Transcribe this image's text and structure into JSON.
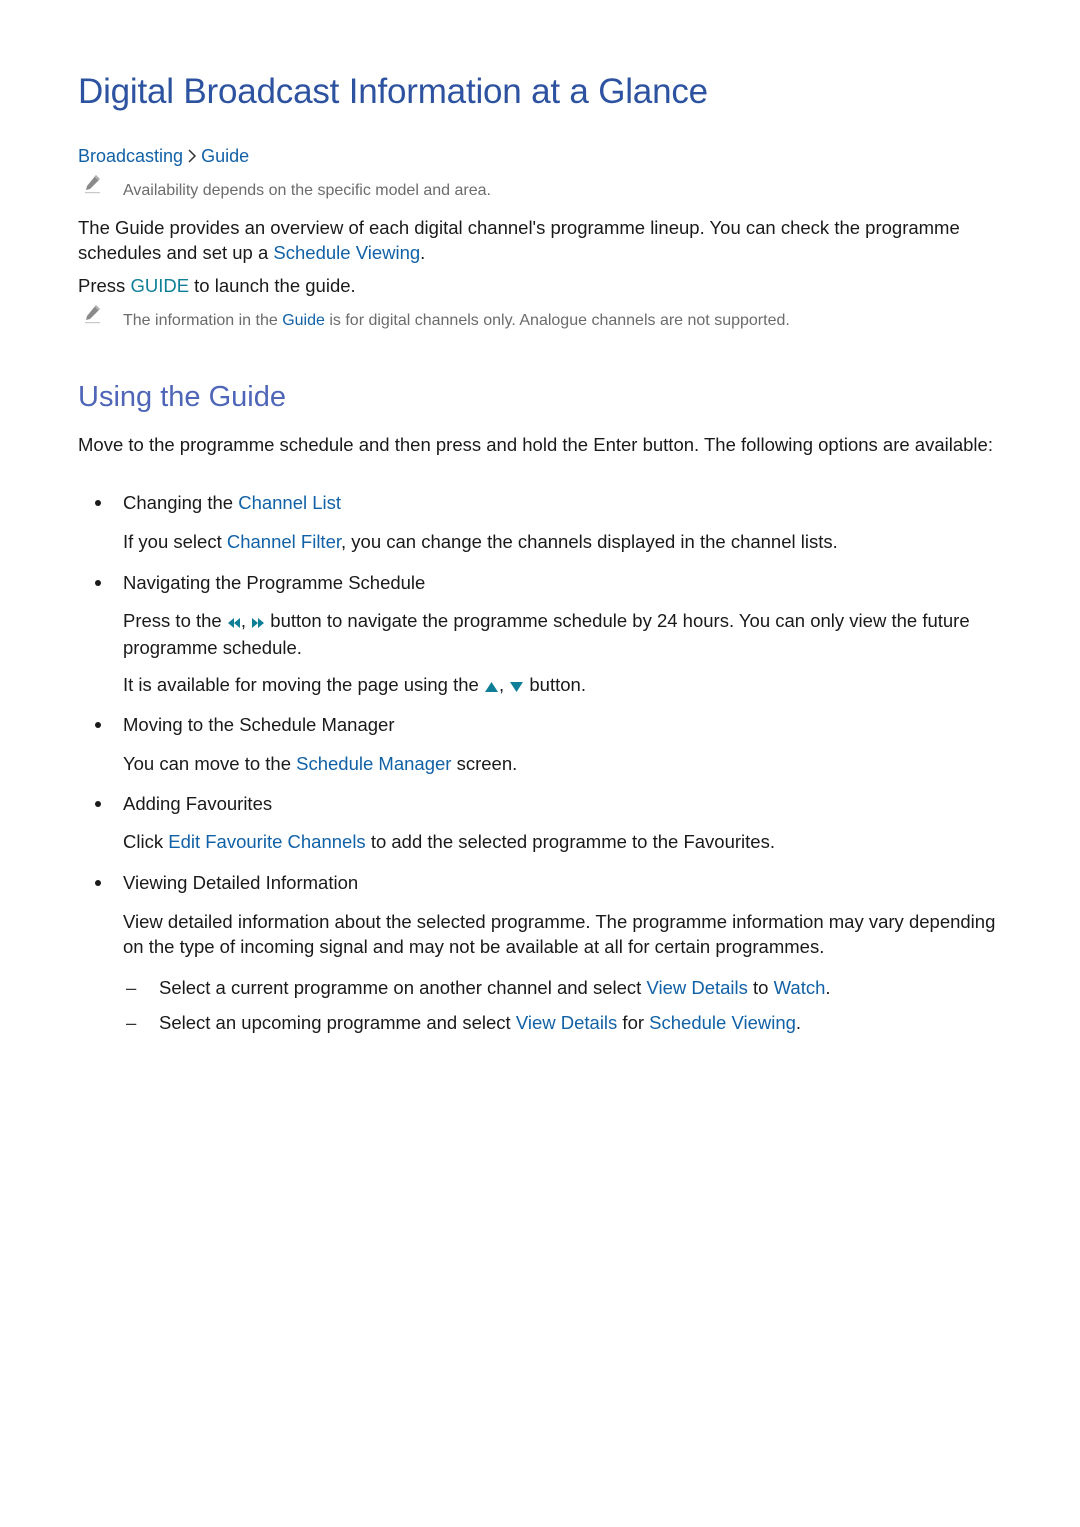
{
  "page_title": "Digital Broadcast Information at a Glance",
  "breadcrumb": {
    "items": [
      "Broadcasting",
      "Guide"
    ],
    "separator_icon": "chevron-right-icon"
  },
  "notes": [
    {
      "icon": "pencil-note-icon",
      "text": "Availability depends on the specific model and area."
    },
    {
      "icon": "pencil-note-icon",
      "pre": "The information in the ",
      "highlight": "Guide",
      "post": " is for digital channels only. Analogue channels are not supported."
    }
  ],
  "intro": {
    "p1_pre": "The Guide provides an overview of each digital channel's programme lineup. You can check the programme schedules and set up a ",
    "p1_link": "Schedule Viewing",
    "p1_post": ".",
    "p2_pre": "Press ",
    "p2_key": "GUIDE",
    "p2_post": " to launch the guide."
  },
  "section": {
    "heading": "Using the Guide",
    "intro": "Move to the programme schedule and then press and hold the Enter button. The following options are available:",
    "items": [
      {
        "label_pre": "Changing the ",
        "label_link": "Channel List",
        "desc_pre": "If you select ",
        "desc_link": "Channel Filter",
        "desc_post": ", you can change the channels displayed in the channel lists."
      },
      {
        "label": "Navigating the Programme Schedule",
        "desc1_pre": "Press to the ",
        "desc1_post": " button to navigate the programme schedule by 24 hours. You can only view the future programme schedule.",
        "desc1_icons": [
          "rewind-icon",
          "fast-forward-icon"
        ],
        "desc2_pre": "It is available for moving the page using the ",
        "desc2_post": " button.",
        "desc2_icons": [
          "up-arrow-icon",
          "down-arrow-icon"
        ]
      },
      {
        "label": "Moving to the Schedule Manager",
        "desc_pre": "You can move to the ",
        "desc_link": "Schedule Manager",
        "desc_post": " screen."
      },
      {
        "label": "Adding Favourites",
        "desc_pre": "Click ",
        "desc_link": "Edit Favourite Channels",
        "desc_post": " to add the selected programme to the Favourites."
      },
      {
        "label": "Viewing Detailed Information",
        "desc": "View detailed information about the selected programme. The programme information may vary depending on the type of incoming signal and may not be available at all for certain programmes.",
        "subitems": [
          {
            "pre": "Select a current programme on another channel and select ",
            "link1": "View Details",
            "mid": " to ",
            "link2": "Watch",
            "post": "."
          },
          {
            "pre": "Select an upcoming programme and select ",
            "link1": "View Details",
            "mid": " for ",
            "link2": "Schedule Viewing",
            "post": "."
          }
        ]
      }
    ]
  },
  "colors": {
    "title": "#2d53a0",
    "heading": "#4f66b8",
    "link": "#1161a7",
    "key": "#0f7f98",
    "note_text": "#6b6b6b",
    "body_text": "#1a1a1a"
  }
}
